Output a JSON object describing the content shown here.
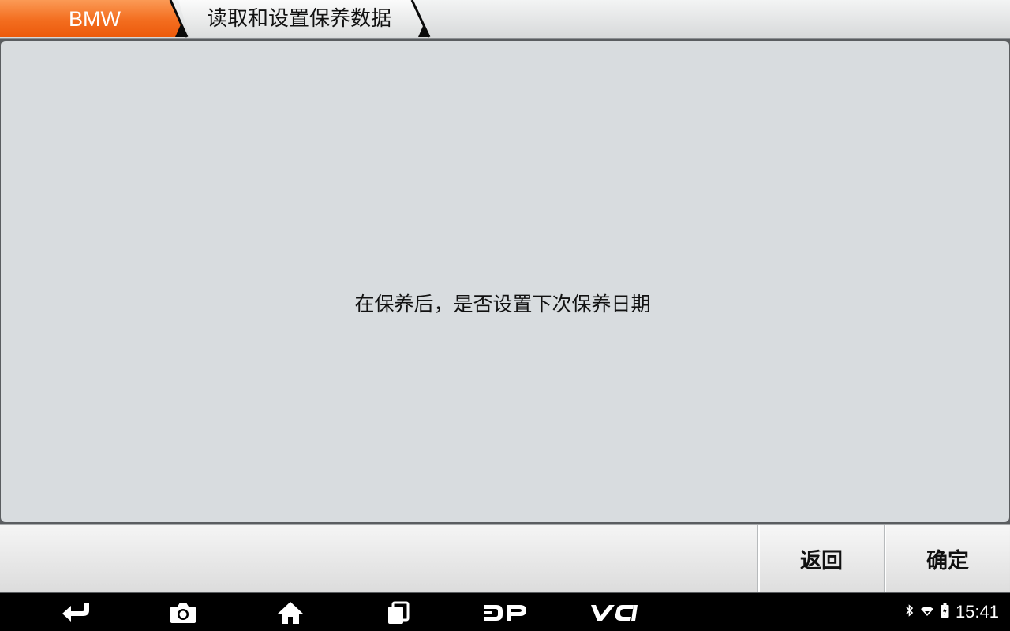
{
  "header": {
    "brand_label": "BMW",
    "page_title": "读取和设置保养数据",
    "accent_color": "#f26a1b"
  },
  "dialog": {
    "message": "在保养后，是否设置下次保养日期"
  },
  "actions": {
    "back_label": "返回",
    "confirm_label": "确定"
  },
  "navbar": {
    "icons": [
      "back-icon",
      "camera-icon",
      "home-icon",
      "recent-apps-icon",
      "dp-icon",
      "vci-icon"
    ],
    "dp_label": "DP",
    "vci_label": "VCI"
  },
  "status": {
    "icons": [
      "bluetooth-icon",
      "wifi-icon",
      "battery-charging-icon"
    ],
    "time": "15:41"
  }
}
